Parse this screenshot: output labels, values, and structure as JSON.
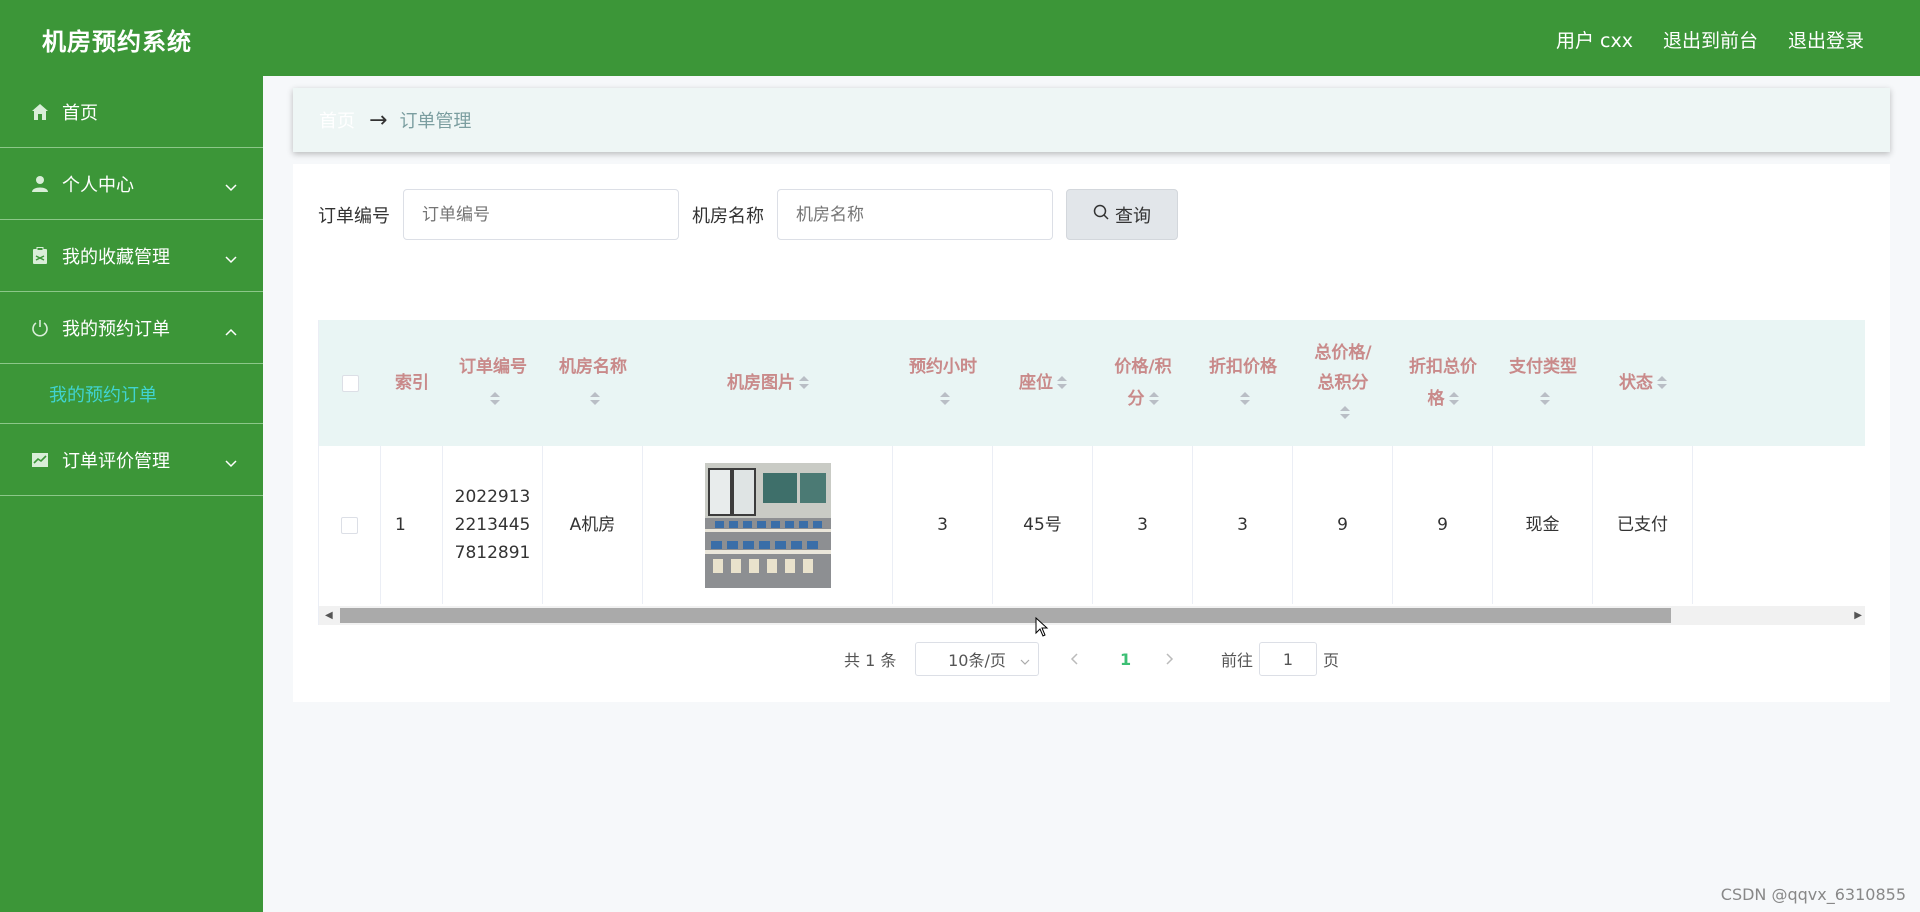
{
  "header": {
    "title": "机房预约系统",
    "user": "用户 cxx",
    "exit_front": "退出到前台",
    "logout": "退出登录"
  },
  "sidebar": {
    "items": [
      {
        "label": "首页",
        "icon": "home-icon"
      },
      {
        "label": "个人中心",
        "icon": "user-icon"
      },
      {
        "label": "我的收藏管理",
        "icon": "clipboard-icon"
      },
      {
        "label": "我的预约订单",
        "icon": "power-icon"
      },
      {
        "label": "订单评价管理",
        "icon": "chart-icon"
      }
    ],
    "submenu_label": "我的预约订单"
  },
  "breadcrumb": {
    "home": "首页",
    "current": "订单管理"
  },
  "search": {
    "order_label": "订单编号",
    "order_placeholder": "订单编号",
    "room_label": "机房名称",
    "room_placeholder": "机房名称",
    "button": "查询"
  },
  "table": {
    "headers": [
      "索引",
      "订单编号",
      "机房名称",
      "机房图片",
      "预约小时",
      "座位",
      "价格/积分",
      "折扣价格",
      "总价格/总积分",
      "折扣总价格",
      "支付类型",
      "状态"
    ],
    "rows": [
      {
        "index": "1",
        "order_no": "20229132213445 7812891",
        "order_no_lines": [
          "2022913",
          "2213445",
          "7812891"
        ],
        "room_name": "A机房",
        "hours": "3",
        "seat": "45号",
        "price": "3",
        "discount_price": "3",
        "total": "9",
        "discount_total": "9",
        "pay_type": "现金",
        "status": "已支付"
      }
    ]
  },
  "pagination": {
    "total": "共 1 条",
    "page_size": "10条/页",
    "current_page": "1",
    "goto_label": "前往",
    "goto_value": "1",
    "page_unit": "页"
  },
  "footer": {
    "watermark": "CSDN @qqvx_6310855"
  },
  "colors": {
    "brand_green": "#3c9638",
    "header_text_accent": "#c98a8a",
    "submenu_active": "#41d3d0"
  }
}
